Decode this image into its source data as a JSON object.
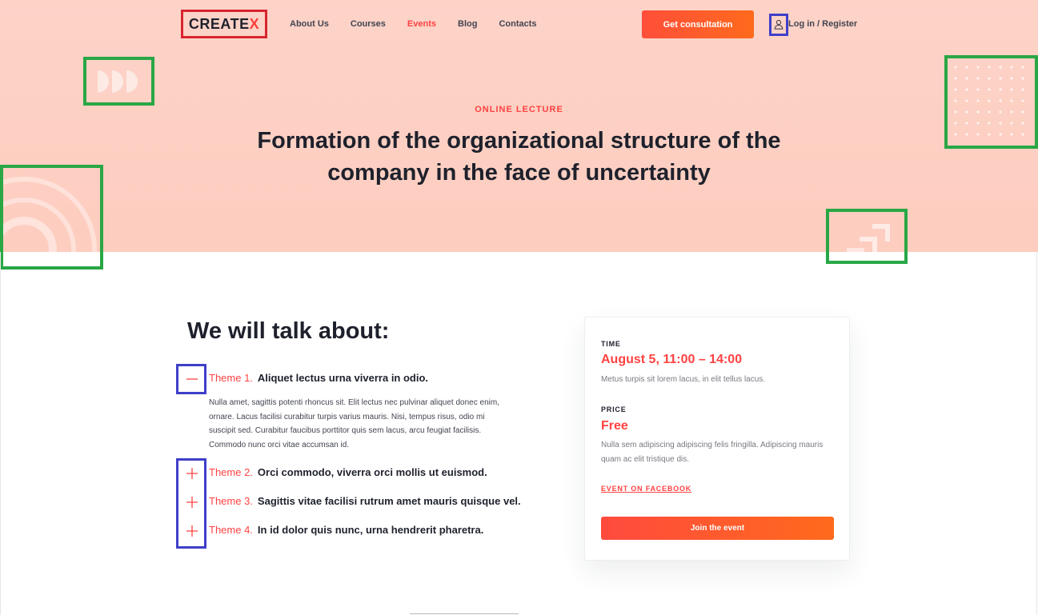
{
  "header": {
    "logo": {
      "text_main": "CREATE",
      "text_accent": "X"
    },
    "nav": [
      {
        "label": "About Us",
        "active": false
      },
      {
        "label": "Courses",
        "active": false
      },
      {
        "label": "Events",
        "active": true
      },
      {
        "label": "Blog",
        "active": false
      },
      {
        "label": "Contacts",
        "active": false
      }
    ],
    "cta_label": "Get consultation",
    "login_icon": "user-icon",
    "login_label": "Log in / Register"
  },
  "hero": {
    "eyebrow": "ONLINE LECTURE",
    "title": "Formation of the organizational structure of the company in the face of uncertainty"
  },
  "talk": {
    "heading": "We will talk about:",
    "themes": [
      {
        "number": "Theme 1.",
        "title": "Aliquet lectus urna viverra in odio.",
        "toggle": "minus-icon",
        "expanded": true,
        "body": "Nulla amet, sagittis potenti rhoncus sit. Elit lectus nec pulvinar aliquet donec enim, ornare. Lacus facilisi curabitur turpis varius mauris. Nisi, tempus risus, odio mi suscipit sed. Curabitur faucibus porttitor quis sem lacus, arcu feugiat facilisis. Commodo nunc orci vitae accumsan id."
      },
      {
        "number": "Theme 2.",
        "title": "Orci commodo, viverra orci mollis ut euismod.",
        "toggle": "plus-icon",
        "expanded": false
      },
      {
        "number": "Theme 3.",
        "title": "Sagittis vitae facilisi rutrum amet mauris quisque vel.",
        "toggle": "plus-icon",
        "expanded": false
      },
      {
        "number": "Theme 4.",
        "title": "In id dolor quis nunc, urna hendrerit pharetra.",
        "toggle": "plus-icon",
        "expanded": false
      }
    ]
  },
  "card": {
    "time_label": "TIME",
    "time_value": "August 5, 11:00 – 14:00",
    "time_desc": "Metus turpis sit lorem lacus, in elit tellus lacus.",
    "price_label": "PRICE",
    "price_value": "Free",
    "price_desc": "Nulla sem adipiscing adipiscing felis fringilla. Adipiscing mauris quam ac elit tristique dis.",
    "facebook_link": "EVENT ON FACEBOOK",
    "join_label": "Join the event"
  },
  "colors": {
    "accent": "#ff4242",
    "hero_bg": "#fdd3c8",
    "heading": "#1e212c"
  }
}
